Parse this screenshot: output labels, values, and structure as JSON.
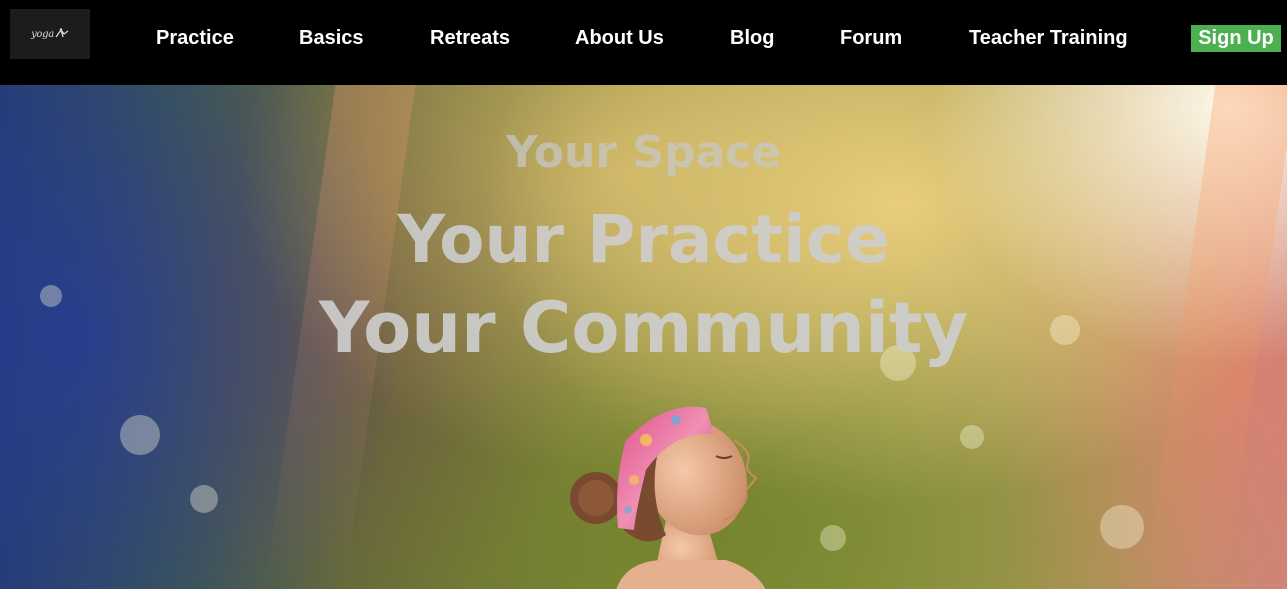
{
  "nav": {
    "logo_text": "yoga",
    "items": [
      "Practice",
      "Basics",
      "Retreats",
      "About Us",
      "Blog",
      "Forum",
      "Teacher Training"
    ],
    "signup_label": "Sign Up",
    "signup_color": "#4caf50"
  },
  "hero": {
    "line1": "Your Space",
    "line2": "Your Practice",
    "line3": "Your Community"
  }
}
